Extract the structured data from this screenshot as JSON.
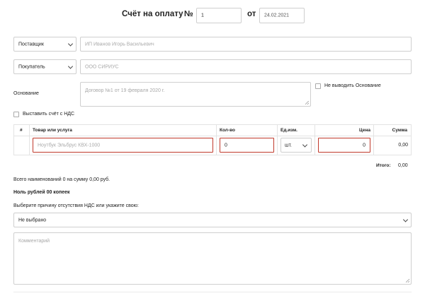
{
  "header": {
    "title": "Счёт на оплату",
    "number_label": "№",
    "number_value": "1",
    "date_label": "от",
    "date_value": "24.02.2021"
  },
  "supplier": {
    "select_value": "Поставщик",
    "placeholder": "ИП Иванов Игорь Васильевич"
  },
  "buyer": {
    "select_value": "Покупатель",
    "placeholder": "ООО СИРИУС"
  },
  "basis": {
    "label": "Основание",
    "placeholder": "Договор №1 от 19 февраля 2020 г.",
    "hide_label": "Не выводить Основание"
  },
  "vat_checkbox_label": "Выставить счёт с НДС",
  "table": {
    "headers": {
      "num": "#",
      "item": "Товар или услуга",
      "qty": "Кол-во",
      "unit": "Ед.изм.",
      "price": "Цена",
      "sum": "Сумма"
    },
    "row": {
      "item_placeholder": "Ноутбук Эльбрус КВХ-1000",
      "qty_value": "0",
      "unit_value": "шт.",
      "price_value": "0",
      "sum_value": "0,00"
    },
    "total_label": "Итого:",
    "total_value": "0,00"
  },
  "summary_text": "Всего наименований 0 на сумму 0,00 руб.",
  "amount_words": "Ноль рублей 00 копеек",
  "vat_reason": {
    "label": "Выберите причину отсутствия НДС или укажите свою:",
    "select_value": "Не выбрано"
  },
  "comment_placeholder": "Комментарий"
}
